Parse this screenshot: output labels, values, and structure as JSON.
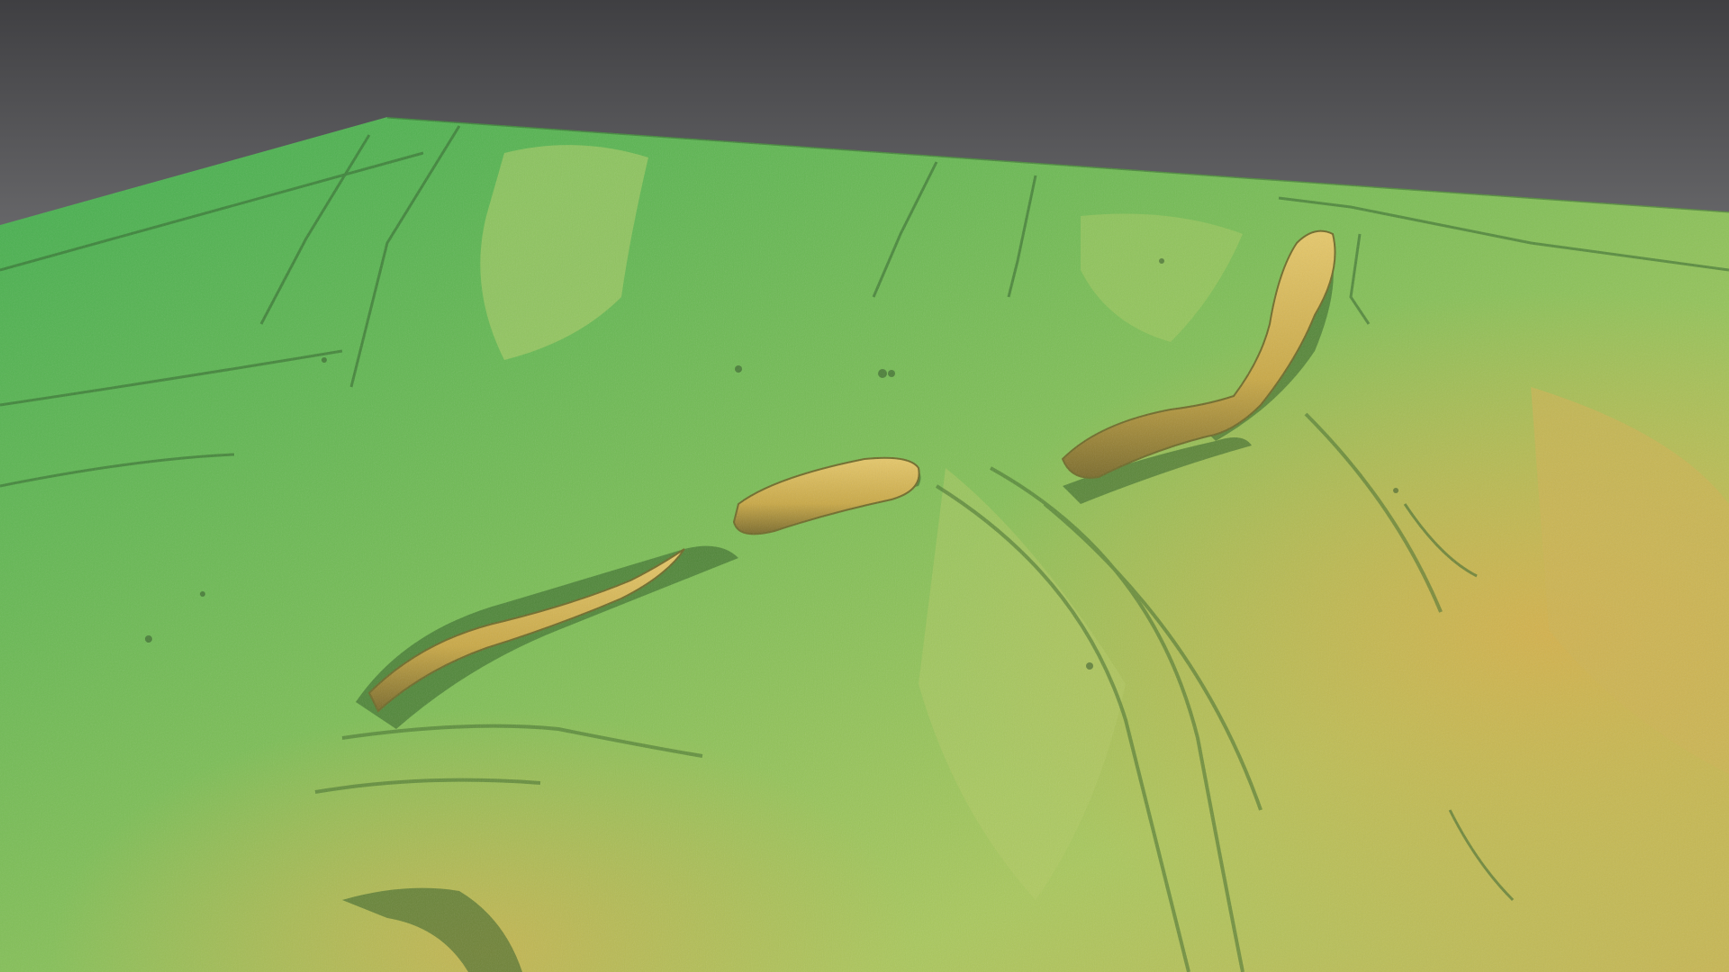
{
  "scene": {
    "subject": "lidar-elevation-terrain-model",
    "colors": {
      "background_top": "#4a4a4d",
      "background_bottom": "#8a8a8c",
      "terrain_low": "#3fae4e",
      "terrain_mid": "#8fc45a",
      "terrain_high": "#d8b84a",
      "terrain_peak": "#e0c060",
      "relief_shadow": "#2c5a22"
    },
    "elevation_legend_visible": false
  }
}
